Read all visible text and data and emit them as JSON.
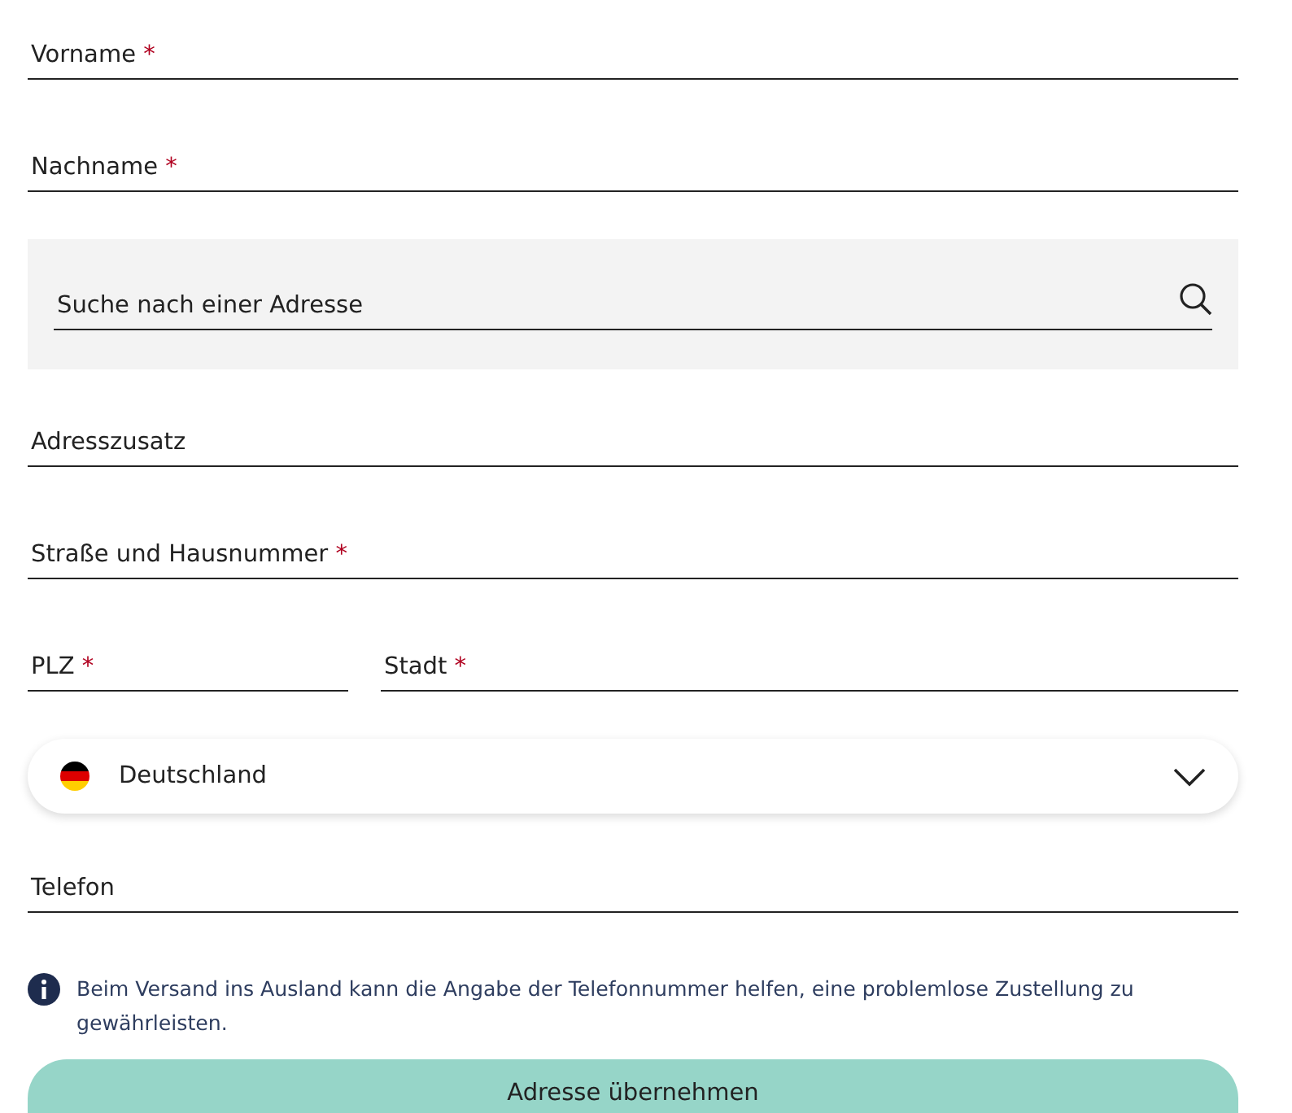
{
  "fields": [
    {
      "kind": "text",
      "label": "Vorname",
      "required_mark": "*"
    },
    {
      "kind": "text",
      "label": "Nachname",
      "required_mark": "*"
    },
    {
      "kind": "search",
      "placeholder": "Suche nach einer Adresse"
    },
    {
      "kind": "text",
      "label": "Adresszusatz"
    },
    {
      "kind": "text",
      "label": "Straße und Hausnummer",
      "required_mark": "*"
    },
    {
      "kind": "pair",
      "items": [
        {
          "label": "PLZ",
          "required_mark": "*"
        },
        {
          "label": "Stadt",
          "required_mark": "*"
        }
      ]
    },
    {
      "kind": "select",
      "value": "Deutschland"
    },
    {
      "kind": "text",
      "label": "Telefon"
    }
  ],
  "hint": "Beim Versand ins Ausland kann die Angabe der Telefonnummer helfen, eine problemlose Zustellung zu gewährleisten.",
  "submit": "Adresse übernehmen"
}
